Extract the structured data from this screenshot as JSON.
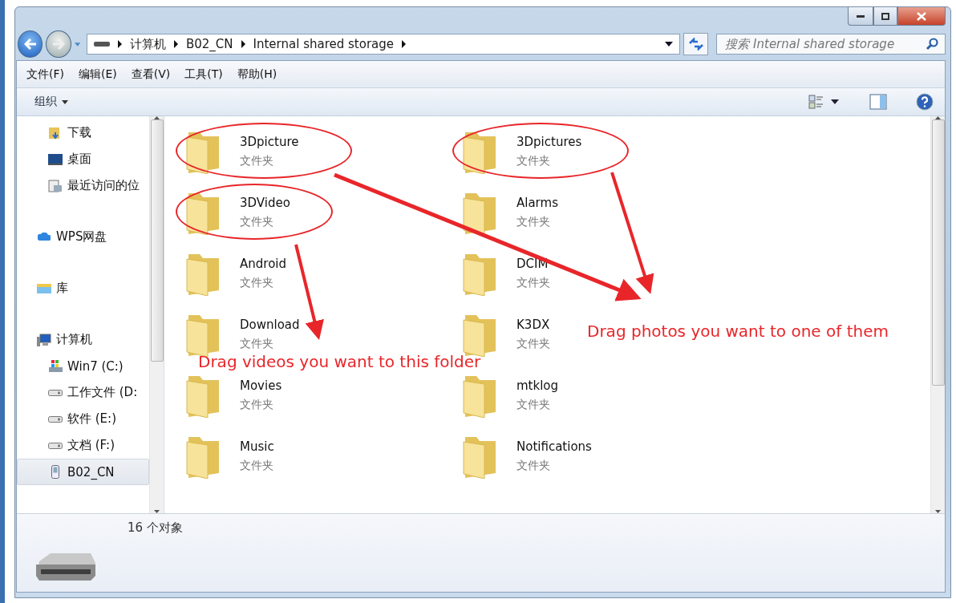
{
  "address_bar": {
    "crumbs": [
      "计算机",
      "B02_CN",
      "Internal shared storage"
    ]
  },
  "search": {
    "placeholder": "搜索 Internal shared storage"
  },
  "menu": [
    "文件(F)",
    "编辑(E)",
    "查看(V)",
    "工具(T)",
    "帮助(H)"
  ],
  "toolbar": {
    "organize": "组织"
  },
  "sidebar": {
    "sections": [
      {
        "children": [
          {
            "label": "下载",
            "kind": "downloads",
            "selected": false
          },
          {
            "label": "桌面",
            "kind": "desktop",
            "selected": false
          },
          {
            "label": "最近访问的位",
            "kind": "recent",
            "selected": false
          }
        ]
      },
      {
        "label": "WPS网盘",
        "kind": "cloud",
        "selected": false
      },
      {
        "label": "库",
        "kind": "library",
        "selected": false
      },
      {
        "label": "计算机",
        "kind": "computer",
        "selected": false,
        "children": [
          {
            "label": "Win7 (C:)",
            "kind": "system",
            "selected": false
          },
          {
            "label": "工作文件 (D:",
            "kind": "drive",
            "selected": false
          },
          {
            "label": "软件 (E:)",
            "kind": "drive",
            "selected": false
          },
          {
            "label": "文档 (F:)",
            "kind": "drive",
            "selected": false
          },
          {
            "label": "B02_CN",
            "kind": "phone",
            "selected": true
          }
        ]
      }
    ]
  },
  "folders": [
    {
      "name": "3Dpicture",
      "type": "文件夹",
      "circled": true
    },
    {
      "name": "3Dpictures",
      "type": "文件夹",
      "circled": true
    },
    {
      "name": "3DVideo",
      "type": "文件夹",
      "circled": true
    },
    {
      "name": "Alarms",
      "type": "文件夹",
      "circled": false
    },
    {
      "name": "Android",
      "type": "文件夹",
      "circled": false
    },
    {
      "name": "DCIM",
      "type": "文件夹",
      "circled": false
    },
    {
      "name": "Download",
      "type": "文件夹",
      "circled": false
    },
    {
      "name": "K3DX",
      "type": "文件夹",
      "circled": false
    },
    {
      "name": "Movies",
      "type": "文件夹",
      "circled": false
    },
    {
      "name": "mtklog",
      "type": "文件夹",
      "circled": false
    },
    {
      "name": "Music",
      "type": "文件夹",
      "circled": false
    },
    {
      "name": "Notifications",
      "type": "文件夹",
      "circled": false
    }
  ],
  "annotations": [
    {
      "text": "Drag photos you want to one of them"
    },
    {
      "text": "Drag videos you want to this folder"
    }
  ],
  "status_bar": {
    "count": "16 个对象"
  }
}
